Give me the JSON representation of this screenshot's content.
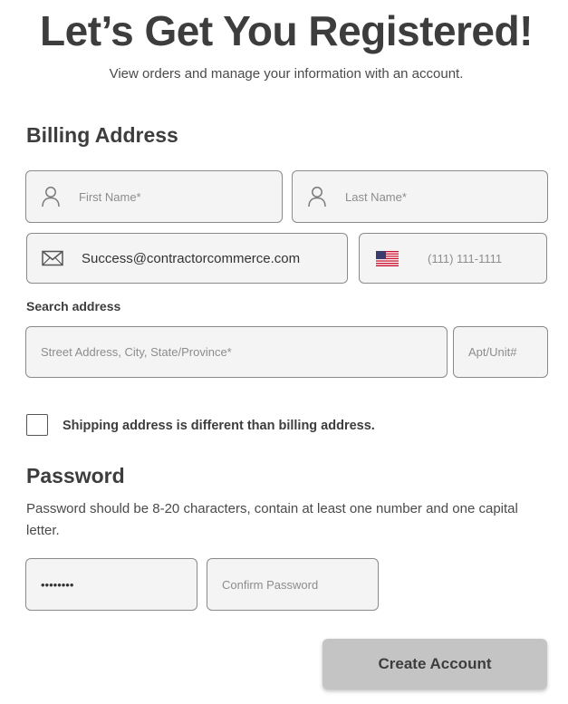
{
  "header": {
    "title": "Let’s Get You Registered!",
    "subtitle": "View orders and manage your information with an account."
  },
  "billing": {
    "section_title": "Billing Address",
    "first_name": {
      "placeholder": "First Name*",
      "value": "",
      "icon": "person-icon"
    },
    "last_name": {
      "placeholder": "Last Name*",
      "value": "",
      "icon": "person-icon"
    },
    "email": {
      "value": "Success@contractorcommerce.com",
      "icon": "envelope-icon"
    },
    "phone": {
      "placeholder": "(111) 111-1111",
      "value": "",
      "flag": "us-flag-icon"
    },
    "search_address_label": "Search address",
    "street": {
      "placeholder": "Street Address, City, State/Province*",
      "value": ""
    },
    "apt": {
      "placeholder": "Apt/Unit#",
      "value": ""
    }
  },
  "shipping": {
    "checkbox_label": "Shipping address is different than billing address.",
    "checked": false
  },
  "password": {
    "section_title": "Password",
    "help_text": "Password should be 8-20 characters, contain at least one number and one capital letter.",
    "password_value_masked": "••••••••",
    "confirm_placeholder": "Confirm Password"
  },
  "actions": {
    "create_account_label": "Create Account"
  },
  "colors": {
    "field_bg": "#f4f4f4",
    "field_border": "#8a8a8a",
    "button_bg": "#c4c4c4",
    "text_dark": "#3d3d3d"
  }
}
